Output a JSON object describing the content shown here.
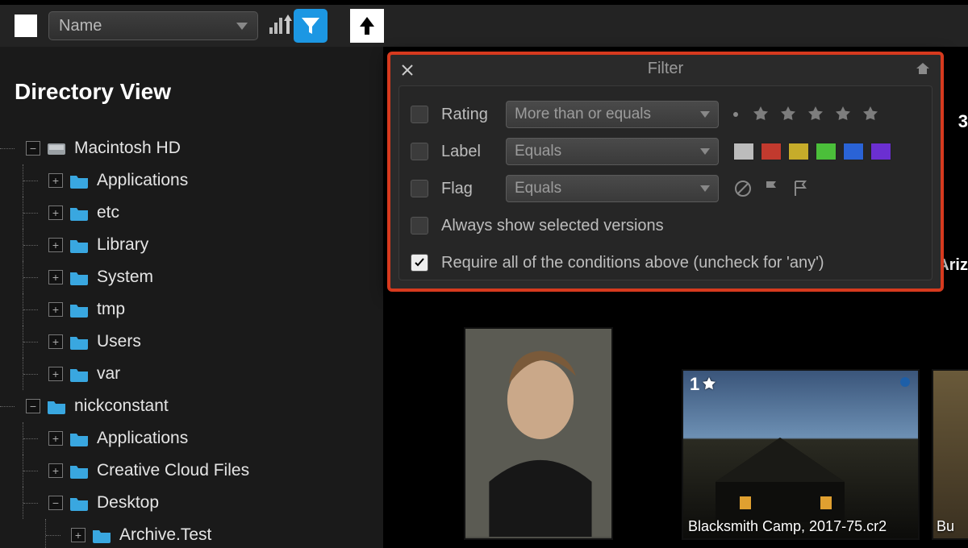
{
  "toolbar": {
    "sort_field": "Name"
  },
  "sidebar": {
    "title": "Directory View",
    "tree": {
      "root": "Macintosh HD",
      "root_children": [
        "Applications",
        "etc",
        "Library",
        "System",
        "tmp",
        "Users",
        "var"
      ],
      "user_root": "nickconstant",
      "user_children": [
        "Applications",
        "Creative Cloud Files",
        "Desktop"
      ],
      "desktop_child": "Archive.Test"
    }
  },
  "filter": {
    "title": "Filter",
    "rows": {
      "rating": {
        "label": "Rating",
        "op": "More than or equals"
      },
      "label": {
        "label": "Label",
        "op": "Equals"
      },
      "flag": {
        "label": "Flag",
        "op": "Equals"
      }
    },
    "swatches": [
      "#bcbcbc",
      "#c23a2e",
      "#c6ac2a",
      "#4bbf3a",
      "#2a63d6",
      "#6b2fd1"
    ],
    "always_show": "Always show selected versions",
    "require_all": "Require all of the conditions above (uncheck for 'any')",
    "require_all_checked": true
  },
  "thumbs": {
    "t2_rating": "1",
    "t2_caption": "Blacksmith Camp, 2017-75.cr2",
    "t3_caption": "Bu"
  },
  "edge": {
    "three": "3",
    "ariz": "Ariz"
  }
}
